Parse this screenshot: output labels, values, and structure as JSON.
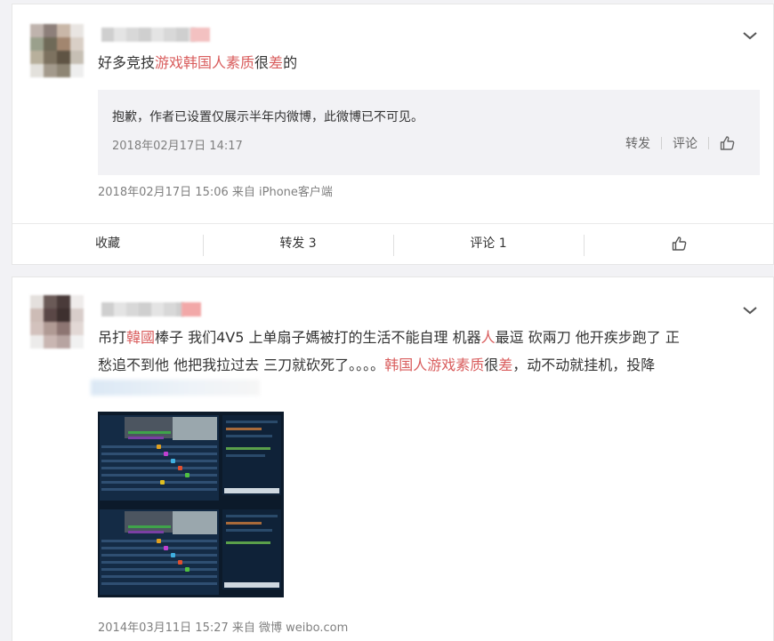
{
  "post1": {
    "text_before": "好多竞技",
    "text_hl": "游戏韩国人素质",
    "text_mid": "很",
    "text_hl2": "差",
    "text_after": "的",
    "quote": {
      "text": "抱歉，作者已设置仅展示半年内微博，此微博已不可见。",
      "time": "2018年02月17日 14:17",
      "repost": "转发",
      "comment": "评论"
    },
    "meta": "2018年02月17日 15:06  来自 iPhone客户端",
    "actions": {
      "favorite": "收藏",
      "repost": "转发 3",
      "comment": "评论 1"
    }
  },
  "post2": {
    "line1_a": "吊打",
    "line1_hl": "韓國",
    "line1_b": "棒子 我们4V5 上单扇子媽被打的生活不能自理 机器",
    "line1_hl2": "人",
    "line1_c": "最逗 砍兩刀 他开疾步跑了 正",
    "line2_a": "愁追不到他 他把我拉过去 三刀就砍死了。。。。",
    "line2_hl": "韩国人游戏素质",
    "line2_b": "很",
    "line2_hl2": "差",
    "line2_c": "，动不动就挂机，投降",
    "meta": "2014年03月11日 15:27  来自 微博 weibo.com"
  },
  "colors": {
    "highlight": "#d95d5d",
    "card": "#ffffff",
    "background": "#f2f2f5",
    "meta": "#808080"
  },
  "icons": {
    "expand": "chevron-down-icon",
    "like": "thumbs-up-icon"
  }
}
